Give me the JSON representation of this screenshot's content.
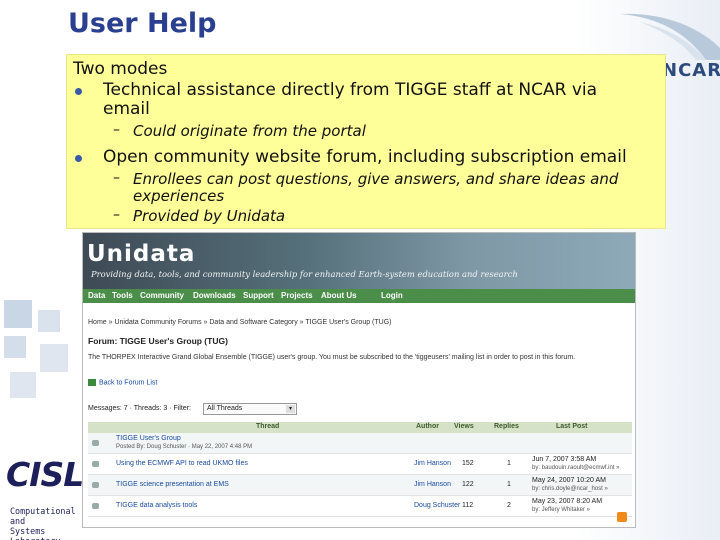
{
  "slide": {
    "title": "User Help",
    "ncar_logo": "NCAR",
    "box": {
      "heading": "Two modes",
      "bullet1_line1": "Technical assistance directly from TIGGE staff at NCAR via",
      "bullet1_line2": "email",
      "bullet1_sub": "Could originate from the portal",
      "bullet2": "Open community website forum, including subscription email",
      "bullet2_sub1_line1": "Enrollees can post questions, give answers, and share ideas and",
      "bullet2_sub1_line2": "experiences",
      "bullet2_sub2": "Provided by Unidata"
    },
    "cisl": {
      "logo": "CISL",
      "sub1": "Computational and",
      "sub2": "Systems Laboratory"
    }
  },
  "forum": {
    "site_title": "Unidata",
    "tagline": "Providing data, tools, and community leadership for enhanced Earth-system education and research",
    "nav": [
      "Data",
      "Tools",
      "Community",
      "Downloads",
      "Support",
      "Projects",
      "About Us",
      "Login"
    ],
    "breadcrumb": "Home » Unidata Community Forums » Data and Software Category » TIGGE User's Group (TUG)",
    "forum_title": "Forum: TIGGE User's Group (TUG)",
    "forum_desc": "The THORPEX Interactive Grand Global Ensemble (TIGGE) user's group. You must be subscribed to the 'tiggeusers' mailing list in order to post in this forum.",
    "back_link": "Back to Forum List",
    "messages_label": "Messages: 7 · Threads: 3 · Filter:",
    "filter_value": "All Threads",
    "columns": [
      "Thread",
      "Author",
      "Views",
      "Replies",
      "Last Post"
    ],
    "rows": [
      {
        "thread": "TIGGE User's Group",
        "sub": "Posted By: Doug Schuster · May 22, 2007 4:48 PM",
        "author": "",
        "views": "",
        "replies": "",
        "last1": "",
        "last2": ""
      },
      {
        "thread": "Using the ECMWF API to read UKMO files",
        "sub": "",
        "author": "Jim Hanson",
        "views": "152",
        "replies": "1",
        "last1": "Jun 7, 2007 3:58 AM",
        "last2": "by: baudouin.raoult@ecmwf.int »"
      },
      {
        "thread": "TIGGE science presentation at EMS",
        "sub": "",
        "author": "Jim Hanson",
        "views": "122",
        "replies": "1",
        "last1": "May 24, 2007 10:20 AM",
        "last2": "by: chris.doyle@ncar_host »"
      },
      {
        "thread": "TIGGE data analysis tools",
        "sub": "",
        "author": "Doug Schuster",
        "views": "112",
        "replies": "2",
        "last1": "May 23, 2007 8:20 AM",
        "last2": "by: Jeffery Whitaker »"
      }
    ]
  }
}
